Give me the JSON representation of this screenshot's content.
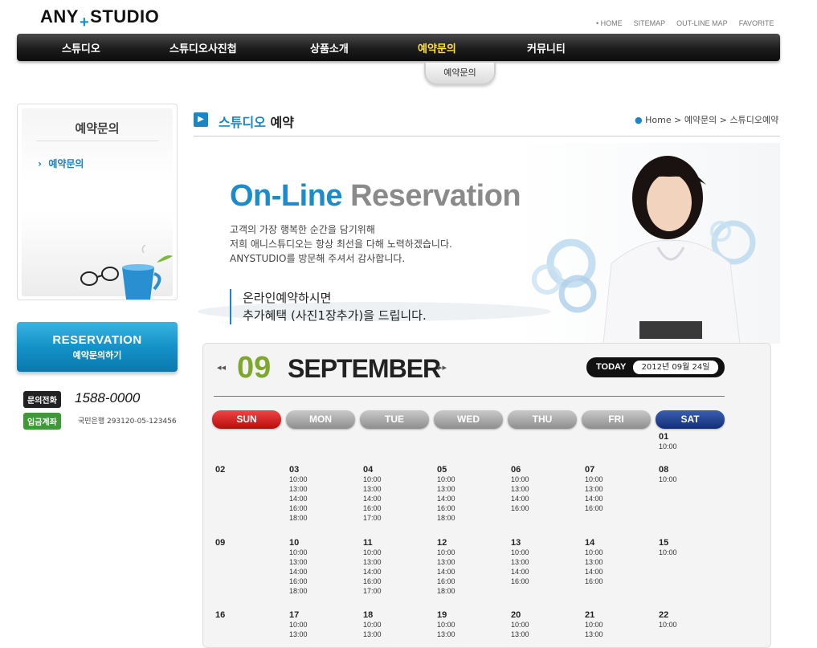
{
  "header": {
    "logo_left": "ANY",
    "logo_plus": "+",
    "logo_right": "STUDIO",
    "toplinks": [
      "HOME",
      "SITEMAP",
      "OUT-LINE MAP",
      "FAVORITE"
    ],
    "nav": [
      "스튜디오",
      "스튜디오사진첩",
      "상품소개",
      "예약문의",
      "커뮤니티"
    ],
    "subtab": "예약문의"
  },
  "sidebar": {
    "title": "예약문의",
    "item": "예약문의",
    "reservation_title": "RESERVATION",
    "reservation_sub": "예약문의하기",
    "phone_label": "문의전화",
    "phone": "1588-0000",
    "account_label": "입금계좌",
    "account": "국민은행 293120-05-123456"
  },
  "content": {
    "title_blue": "스튜디오",
    "title_dark": "예약",
    "breadcrumb": [
      "Home",
      "예약문의",
      "스튜디오예약"
    ]
  },
  "banner": {
    "headline_blue": "On-Line",
    "headline_gray": "Reservation",
    "line1": "고객의 가장 행복한 순간을 담기위해",
    "line2": "저희 애니스튜디오는 항상 최선을 다해 노력하겠습니다.",
    "line3": "ANYSTUDIO를 방문해 주셔서 감사합니다.",
    "quote1": "온라인예약하시면",
    "quote2": "추가혜택 (사진1장추가)을 드립니다."
  },
  "calendar": {
    "month_num": "09",
    "month_name": "SEPTEMBER",
    "prev": "◂◂",
    "next": "▸▸",
    "today_label": "TODAY",
    "today_value": "2012년 09월 24일",
    "days_of_week": [
      "SUN",
      "MON",
      "TUE",
      "WED",
      "THU",
      "FRI",
      "SAT"
    ],
    "weeks": [
      [
        null,
        null,
        null,
        null,
        null,
        null,
        {
          "d": "01",
          "t": [
            "10:00"
          ]
        }
      ],
      [
        {
          "d": "02",
          "t": []
        },
        {
          "d": "03",
          "t": [
            "10:00",
            "13:00",
            "14:00",
            "16:00",
            "18:00"
          ]
        },
        {
          "d": "04",
          "t": [
            "10:00",
            "13:00",
            "14:00",
            "16:00",
            "17:00"
          ]
        },
        {
          "d": "05",
          "t": [
            "10:00",
            "13:00",
            "14:00",
            "16:00",
            "18:00"
          ]
        },
        {
          "d": "06",
          "t": [
            "10:00",
            "13:00",
            "14:00",
            "16:00"
          ]
        },
        {
          "d": "07",
          "t": [
            "10:00",
            "13:00",
            "14:00",
            "16:00"
          ]
        },
        {
          "d": "08",
          "t": [
            "10:00"
          ]
        }
      ],
      [
        {
          "d": "09",
          "t": []
        },
        {
          "d": "10",
          "t": [
            "10:00",
            "13:00",
            "14:00",
            "16:00",
            "18:00"
          ]
        },
        {
          "d": "11",
          "t": [
            "10:00",
            "13:00",
            "14:00",
            "16:00",
            "17:00"
          ]
        },
        {
          "d": "12",
          "t": [
            "10:00",
            "13:00",
            "14:00",
            "16:00",
            "18:00"
          ]
        },
        {
          "d": "13",
          "t": [
            "10:00",
            "13:00",
            "14:00",
            "16:00"
          ]
        },
        {
          "d": "14",
          "t": [
            "10:00",
            "13:00",
            "14:00",
            "16:00"
          ]
        },
        {
          "d": "15",
          "t": [
            "10:00"
          ]
        }
      ],
      [
        {
          "d": "16",
          "t": []
        },
        {
          "d": "17",
          "t": [
            "10:00",
            "13:00"
          ]
        },
        {
          "d": "18",
          "t": [
            "10:00",
            "13:00"
          ]
        },
        {
          "d": "19",
          "t": [
            "10:00",
            "13:00"
          ]
        },
        {
          "d": "20",
          "t": [
            "10:00",
            "13:00"
          ]
        },
        {
          "d": "21",
          "t": [
            "10:00",
            "13:00"
          ]
        },
        {
          "d": "22",
          "t": [
            "10:00"
          ]
        }
      ]
    ]
  }
}
